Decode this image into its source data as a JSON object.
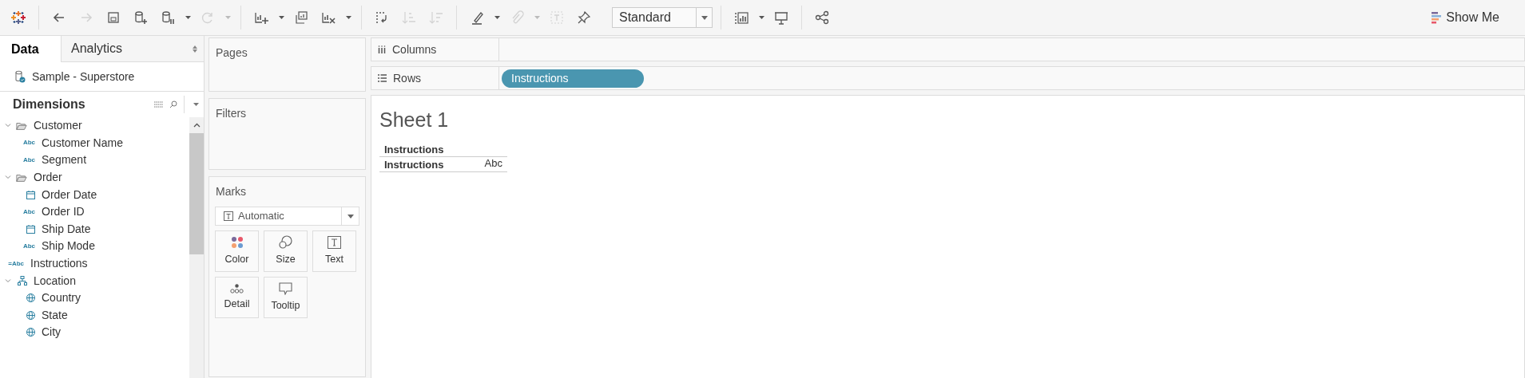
{
  "toolbar": {
    "buttons": [
      {
        "disabled": false
      },
      {
        "disabled": false
      },
      {
        "disabled": true
      },
      {
        "disabled": false
      },
      {
        "disabled": false
      },
      {
        "disabled": false,
        "dropdown": true
      },
      {
        "disabled": true,
        "dropdown": true
      },
      {
        "disabled": false,
        "dropdown": true
      },
      {
        "disabled": false
      },
      {
        "disabled": false,
        "dropdown": true
      },
      {
        "disabled": false
      },
      {
        "disabled": true
      },
      {
        "disabled": true
      },
      {
        "disabled": false,
        "dropdown": true
      },
      {
        "disabled": true,
        "dropdown": true
      },
      {
        "disabled": true
      },
      {
        "disabled": false
      },
      {
        "disabled": false,
        "dropdown": true
      },
      {
        "disabled": false
      },
      {
        "disabled": false
      }
    ],
    "fit_select": {
      "value": "Standard"
    },
    "show_me": {
      "label": "Show Me"
    }
  },
  "data_pane": {
    "tabs": [
      {
        "label": "Data",
        "selected": true
      },
      {
        "label": "Analytics",
        "selected": false
      }
    ],
    "datasource": "Sample - Superstore",
    "section_title": "Dimensions",
    "tree": [
      {
        "kind": "folder",
        "label": "Customer",
        "expanded": true,
        "children": [
          {
            "kind": "text",
            "type_label": "Abc",
            "label": "Customer Name"
          },
          {
            "kind": "text",
            "type_label": "Abc",
            "label": "Segment"
          }
        ]
      },
      {
        "kind": "folder",
        "label": "Order",
        "expanded": true,
        "children": [
          {
            "kind": "date",
            "label": "Order Date"
          },
          {
            "kind": "text",
            "type_label": "Abc",
            "label": "Order ID"
          },
          {
            "kind": "date",
            "label": "Ship Date"
          },
          {
            "kind": "text",
            "type_label": "Abc",
            "label": "Ship Mode"
          }
        ]
      },
      {
        "kind": "calc",
        "type_label": "=Abc",
        "label": "Instructions"
      },
      {
        "kind": "hierarchy",
        "label": "Location",
        "expanded": true,
        "children": [
          {
            "kind": "geo",
            "label": "Country"
          },
          {
            "kind": "geo",
            "label": "State"
          },
          {
            "kind": "geo",
            "label": "City"
          }
        ]
      }
    ]
  },
  "cards": {
    "pages": "Pages",
    "filters": "Filters",
    "marks": {
      "title": "Marks",
      "mark_type": "Automatic",
      "buttons": [
        {
          "kind": "color",
          "label": "Color"
        },
        {
          "kind": "size",
          "label": "Size"
        },
        {
          "kind": "text",
          "label": "Text"
        },
        {
          "kind": "detail",
          "label": "Detail"
        },
        {
          "kind": "tooltip",
          "label": "Tooltip"
        }
      ]
    }
  },
  "columns_shelf": {
    "label": "Columns"
  },
  "rows_shelf": {
    "label": "Rows",
    "pills": [
      {
        "label": "Instructions"
      }
    ]
  },
  "sheet": {
    "title": "Sheet 1",
    "header": "Instructions",
    "rows": [
      {
        "label": "Instructions",
        "value": "Abc"
      }
    ]
  }
}
